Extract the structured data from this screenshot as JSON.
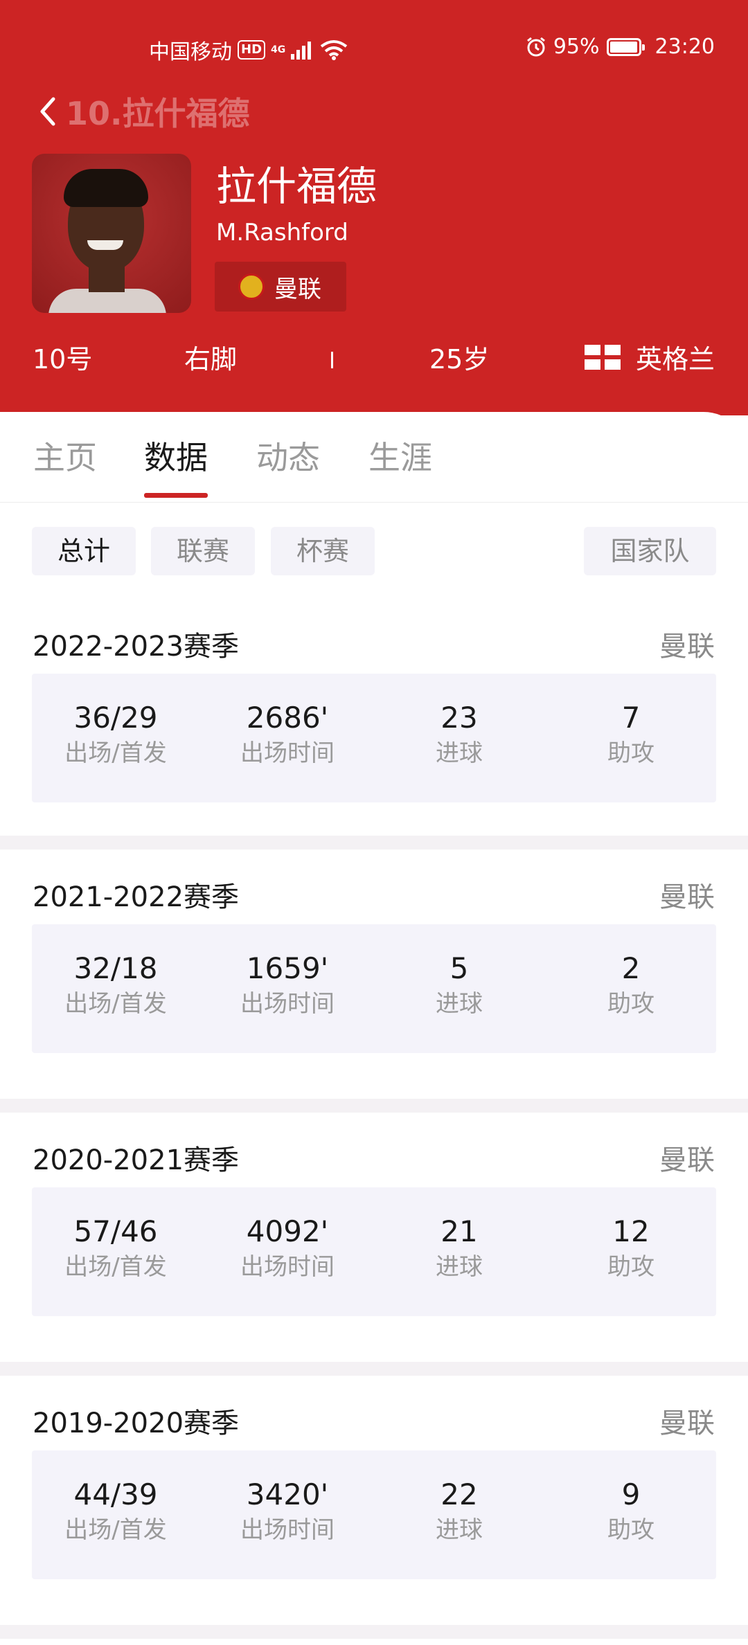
{
  "status_bar": {
    "carrier": "中国移动",
    "hd": "HD",
    "network": "4G",
    "battery": "95%",
    "time": "23:20"
  },
  "nav": {
    "back_title": "10.拉什福德"
  },
  "player": {
    "name_cn": "拉什福德",
    "name_en": "M.Rashford",
    "team": "曼联",
    "number": "10号",
    "foot": "右脚",
    "age": "25岁",
    "nationality": "英格兰"
  },
  "tabs": [
    {
      "label": "主页",
      "active": false
    },
    {
      "label": "数据",
      "active": true
    },
    {
      "label": "动态",
      "active": false
    },
    {
      "label": "生涯",
      "active": false
    }
  ],
  "filters": [
    {
      "label": "总计",
      "active": true
    },
    {
      "label": "联赛",
      "active": false
    },
    {
      "label": "杯赛",
      "active": false
    },
    {
      "label": "国家队",
      "active": false
    }
  ],
  "stat_labels": [
    "出场/首发",
    "出场时间",
    "进球",
    "助攻"
  ],
  "seasons": [
    {
      "title": "2022-2023赛季",
      "team": "曼联",
      "values": [
        "36/29",
        "2686'",
        "23",
        "7"
      ]
    },
    {
      "title": "2021-2022赛季",
      "team": "曼联",
      "values": [
        "32/18",
        "1659'",
        "5",
        "2"
      ]
    },
    {
      "title": "2020-2021赛季",
      "team": "曼联",
      "values": [
        "57/46",
        "4092'",
        "21",
        "12"
      ]
    },
    {
      "title": "2019-2020赛季",
      "team": "曼联",
      "values": [
        "44/39",
        "3420'",
        "22",
        "9"
      ]
    }
  ],
  "colors": {
    "header_red": "#cc2424",
    "accent": "#cc2424",
    "stat_box_bg": "#f4f3fa"
  }
}
